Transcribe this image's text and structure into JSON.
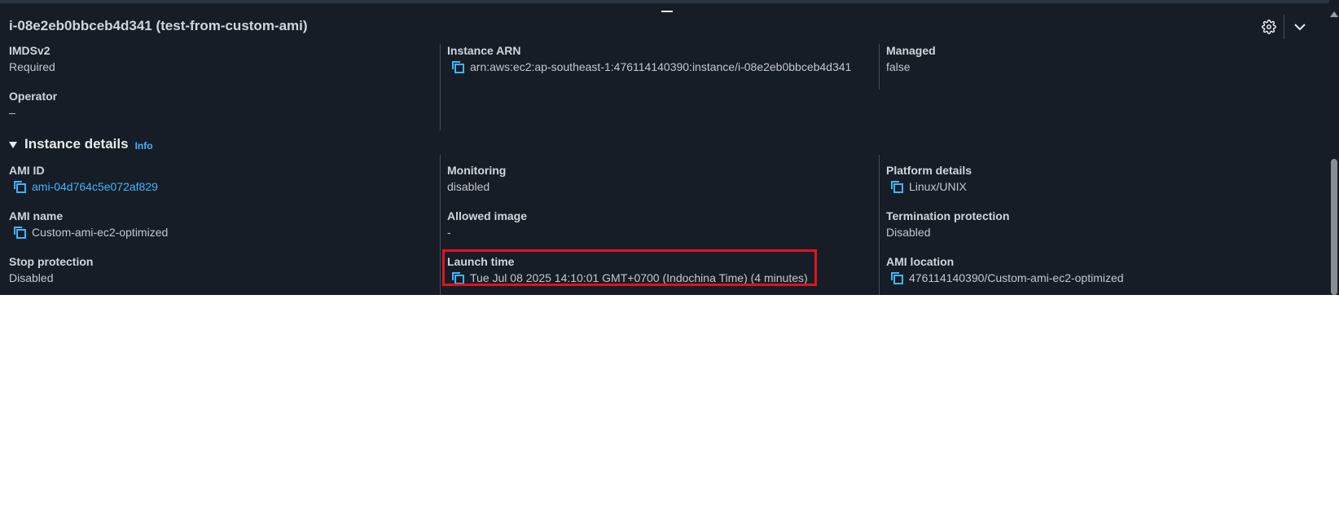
{
  "header": {
    "title": "i-08e2eb0bbceb4d341 (test-from-custom-ami)"
  },
  "top_fields": [
    {
      "label": "IMDSv2",
      "value": "Required"
    },
    {
      "label": "Instance ARN",
      "value": "arn:aws:ec2:ap-southeast-1:476114140390:instance/i-08e2eb0bbceb4d341"
    },
    {
      "label": "Managed",
      "value": "false"
    },
    {
      "label": "Operator",
      "value": "–"
    }
  ],
  "section": {
    "title": "Instance details",
    "info": "Info"
  },
  "details": {
    "ami_id": {
      "label": "AMI ID",
      "value": "ami-04d764c5e072af829"
    },
    "monitoring": {
      "label": "Monitoring",
      "value": "disabled"
    },
    "platform_details": {
      "label": "Platform details",
      "value": "Linux/UNIX"
    },
    "ami_name": {
      "label": "AMI name",
      "value": "Custom-ami-ec2-optimized"
    },
    "allowed_image": {
      "label": "Allowed image",
      "value": "-"
    },
    "termination_protection": {
      "label": "Termination protection",
      "value": "Disabled"
    },
    "stop_protection": {
      "label": "Stop protection",
      "value": "Disabled"
    },
    "launch_time": {
      "label": "Launch time",
      "value": "Tue Jul 08 2025 14:10:01 GMT+0700 (Indochina Time) (4 minutes)"
    },
    "ami_location": {
      "label": "AMI location",
      "value": "476114140390/Custom-ami-ec2-optimized"
    }
  },
  "icons": {
    "gear": "gear-icon",
    "chevron": "chevron-down-icon",
    "copy": "copy-icon",
    "caret": "caret-down-icon"
  },
  "colors": {
    "panel_bg": "#161d26",
    "link": "#42b4ff",
    "highlight": "#e0141e"
  }
}
